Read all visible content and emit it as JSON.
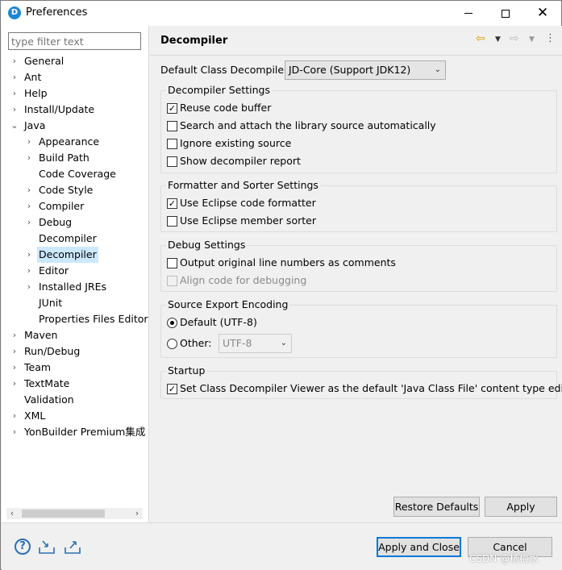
{
  "window": {
    "title": "Preferences",
    "app_icon": "eclipse-icon",
    "minimize_icon": "minimize-icon",
    "maximize_icon": "maximize-icon",
    "close_icon": "close-icon",
    "close_glyph": "✕"
  },
  "sidebar": {
    "filter_placeholder": "type filter text",
    "items": [
      {
        "label": "General",
        "level": 0,
        "expander": "collapsed"
      },
      {
        "label": "Ant",
        "level": 0,
        "expander": "collapsed"
      },
      {
        "label": "Help",
        "level": 0,
        "expander": "collapsed"
      },
      {
        "label": "Install/Update",
        "level": 0,
        "expander": "collapsed"
      },
      {
        "label": "Java",
        "level": 0,
        "expander": "expanded"
      },
      {
        "label": "Appearance",
        "level": 1,
        "expander": "collapsed"
      },
      {
        "label": "Build Path",
        "level": 1,
        "expander": "collapsed"
      },
      {
        "label": "Code Coverage",
        "level": 1,
        "expander": "none"
      },
      {
        "label": "Code Style",
        "level": 1,
        "expander": "collapsed"
      },
      {
        "label": "Compiler",
        "level": 1,
        "expander": "collapsed"
      },
      {
        "label": "Debug",
        "level": 1,
        "expander": "collapsed"
      },
      {
        "label": "Decompiler",
        "level": 1,
        "expander": "none"
      },
      {
        "label": "Decompiler",
        "level": 1,
        "expander": "collapsed",
        "selected": true
      },
      {
        "label": "Editor",
        "level": 1,
        "expander": "collapsed"
      },
      {
        "label": "Installed JREs",
        "level": 1,
        "expander": "collapsed"
      },
      {
        "label": "JUnit",
        "level": 1,
        "expander": "none"
      },
      {
        "label": "Properties Files Editor",
        "level": 1,
        "expander": "none"
      },
      {
        "label": "Maven",
        "level": 0,
        "expander": "collapsed"
      },
      {
        "label": "Run/Debug",
        "level": 0,
        "expander": "collapsed"
      },
      {
        "label": "Team",
        "level": 0,
        "expander": "collapsed"
      },
      {
        "label": "TextMate",
        "level": 0,
        "expander": "collapsed"
      },
      {
        "label": "Validation",
        "level": 0,
        "expander": "none"
      },
      {
        "label": "XML",
        "level": 0,
        "expander": "collapsed"
      },
      {
        "label": "YonBuilder Premium集成",
        "level": 0,
        "expander": "collapsed"
      }
    ],
    "scroll_left_glyph": "‹",
    "scroll_right_glyph": "›"
  },
  "page": {
    "title": "Decompiler",
    "back_icon": "back-arrow-icon",
    "forward_icon": "forward-arrow-icon",
    "menu_icon": "view-menu-icon",
    "default_decompiler_label": "Default Class Decompiler",
    "default_decompiler_value": "JD-Core (Support JDK12)",
    "groups": {
      "decompiler_settings": {
        "title": "Decompiler Settings",
        "options": [
          {
            "label": "Reuse code buffer",
            "checked": true
          },
          {
            "label": "Search and attach the library source automatically",
            "checked": false
          },
          {
            "label": "Ignore existing source",
            "checked": false
          },
          {
            "label": "Show decompiler report",
            "checked": false
          }
        ]
      },
      "formatter_settings": {
        "title": "Formatter and Sorter Settings",
        "options": [
          {
            "label": "Use Eclipse code formatter",
            "checked": true
          },
          {
            "label": "Use Eclipse member sorter",
            "checked": false
          }
        ]
      },
      "debug_settings": {
        "title": "Debug Settings",
        "options": [
          {
            "label": "Output original line numbers as comments",
            "checked": false
          },
          {
            "label": "Align code for debugging",
            "checked": false,
            "disabled": true
          }
        ]
      },
      "encoding": {
        "title": "Source Export Encoding",
        "default_label": "Default (UTF-8)",
        "other_label": "Other:",
        "other_value": "UTF-8",
        "selected": "default"
      },
      "startup": {
        "title": "Startup",
        "options": [
          {
            "label": "Set Class Decompiler Viewer as the default 'Java Class File' content type editor",
            "checked": true
          }
        ]
      }
    },
    "restore_defaults_label": "Restore Defaults",
    "apply_label": "Apply"
  },
  "footer": {
    "help_icon": "help-icon",
    "import_icon": "import-icon",
    "export_icon": "export-icon",
    "apply_close_label": "Apply and Close",
    "cancel_label": "Cancel"
  },
  "watermark": "CSDN @杨梅水",
  "glyphs": {
    "check": "✓",
    "chevron_collapsed": "›",
    "chevron_expanded": "⌄",
    "dropdown": "⌄"
  }
}
